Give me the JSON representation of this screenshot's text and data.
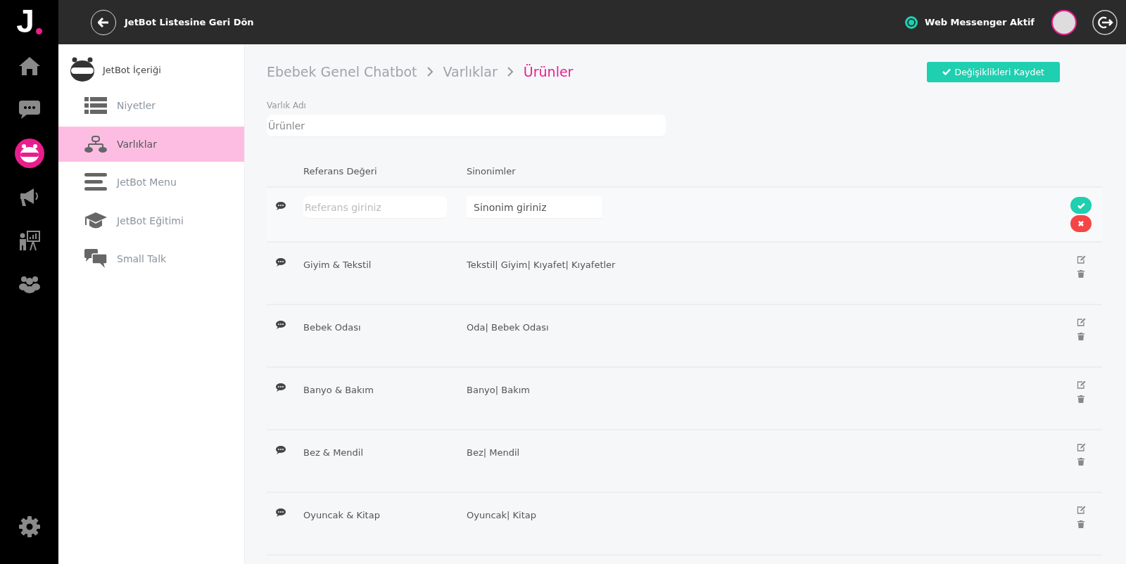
{
  "nav_rail": [
    {
      "kind": "home",
      "selected": false
    },
    {
      "kind": "chat",
      "selected": false
    },
    {
      "kind": "bot",
      "selected": true
    },
    {
      "kind": "megaphone",
      "selected": false
    },
    {
      "kind": "presentation",
      "selected": false
    },
    {
      "kind": "group",
      "selected": false
    }
  ],
  "logo": {
    "letter": "J"
  },
  "topbar": {
    "back_label": "JetBot Listesine Geri Dön",
    "status": "Web Messenger Aktif",
    "status_on": true
  },
  "sidebar": {
    "title": "JetBot İçeriği",
    "items": [
      {
        "kind": "grid",
        "label": "Niyetler",
        "selected": false
      },
      {
        "kind": "hierarchy",
        "label": "Varlıklar",
        "selected": true
      },
      {
        "kind": "lines",
        "label": "JetBot Menu",
        "selected": false
      },
      {
        "kind": "cap",
        "label": "JetBot Eğitimi",
        "selected": false
      },
      {
        "kind": "chat",
        "label": "Small Talk",
        "selected": false
      }
    ]
  },
  "breadcrumb": [
    "Ebebek Genel Chatbot",
    "Varlıklar",
    "Ürünler"
  ],
  "save_button": "Değişiklikleri Kaydet",
  "entity_name": {
    "label": "Varlık Adı",
    "value": "Ürünler"
  },
  "table": {
    "columns": [
      "Referans Değeri",
      "Sinonimler"
    ],
    "new_row": {
      "reference_placeholder": "Referans giriniz",
      "synonym_value": "Sinonim giriniz"
    },
    "rows": [
      {
        "reference": "Giyim & Tekstil",
        "synonyms": "Tekstil| Giyim| Kıyafet| Kıyafetler"
      },
      {
        "reference": "Bebek Odası",
        "synonyms": "Oda| Bebek Odası"
      },
      {
        "reference": "Banyo & Bakım",
        "synonyms": "Banyo| Bakım"
      },
      {
        "reference": "Bez & Mendil",
        "synonyms": "Bez| Mendil"
      },
      {
        "reference": "Oyuncak & Kitap",
        "synonyms": "Oyuncak| Kitap"
      }
    ]
  }
}
